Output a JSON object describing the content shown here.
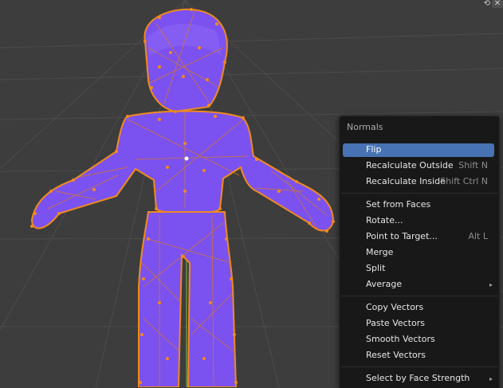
{
  "window": {
    "close_icon": "close-icon",
    "toggle_icon": "overlay-toggle-icon"
  },
  "colors": {
    "background": "#3d3d3d",
    "mesh_fill": "#7b52f0",
    "vertex": "#f08a1f",
    "menu_bg": "#181818",
    "highlight": "#4772b3"
  },
  "menu": {
    "title": "Normals",
    "items": [
      {
        "label": "Flip",
        "shortcut": "",
        "highlighted": true
      },
      {
        "label": "Recalculate Outside",
        "shortcut": "Shift N"
      },
      {
        "label": "Recalculate Inside",
        "shortcut": "Shift Ctrl N"
      },
      {
        "label": "Set from Faces",
        "shortcut": ""
      },
      {
        "label": "Rotate...",
        "shortcut": ""
      },
      {
        "label": "Point to Target...",
        "shortcut": "Alt L"
      },
      {
        "label": "Merge",
        "shortcut": ""
      },
      {
        "label": "Split",
        "shortcut": ""
      },
      {
        "label": "Average",
        "shortcut": "",
        "submenu": true,
        "arrow": "▸"
      },
      {
        "label": "Copy Vectors",
        "shortcut": ""
      },
      {
        "label": "Paste Vectors",
        "shortcut": ""
      },
      {
        "label": "Smooth Vectors",
        "shortcut": ""
      },
      {
        "label": "Reset Vectors",
        "shortcut": ""
      },
      {
        "label": "Select by Face Strength",
        "shortcut": "",
        "submenu": true,
        "arrow": "▸"
      }
    ]
  }
}
